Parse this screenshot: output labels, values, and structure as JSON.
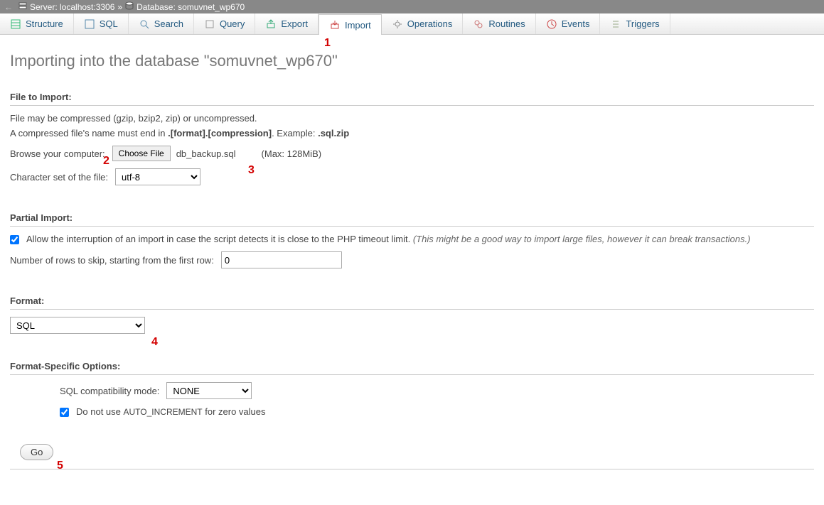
{
  "breadcrumb": {
    "back_arrow": "←",
    "server_label": "Server: localhost:3306",
    "sep": "»",
    "db_label": "Database: somuvnet_wp670"
  },
  "tabs": [
    {
      "label": "Structure",
      "icon": "structure"
    },
    {
      "label": "SQL",
      "icon": "sql"
    },
    {
      "label": "Search",
      "icon": "search"
    },
    {
      "label": "Query",
      "icon": "query"
    },
    {
      "label": "Export",
      "icon": "export"
    },
    {
      "label": "Import",
      "icon": "import",
      "active": true
    },
    {
      "label": "Operations",
      "icon": "operations"
    },
    {
      "label": "Routines",
      "icon": "routines"
    },
    {
      "label": "Events",
      "icon": "events"
    },
    {
      "label": "Triggers",
      "icon": "triggers"
    }
  ],
  "page": {
    "title": "Importing into the database \"somuvnet_wp670\""
  },
  "file_section": {
    "title": "File to Import:",
    "help1": "File may be compressed (gzip, bzip2, zip) or uncompressed.",
    "help2_a": "A compressed file's name must end in ",
    "help2_b": ".[format].[compression]",
    "help2_c": ". Example: ",
    "help2_d": ".sql.zip",
    "browse_label": "Browse your computer:",
    "choose_button": "Choose File",
    "file_name": "db_backup.sql",
    "max_size": "(Max: 128MiB)",
    "charset_label": "Character set of the file:",
    "charset_value": "utf-8"
  },
  "partial_section": {
    "title": "Partial Import:",
    "allow_checked": true,
    "allow_label": "Allow the interruption of an import in case the script detects it is close to the PHP timeout limit. ",
    "allow_hint": "(This might be a good way to import large files, however it can break transactions.)",
    "skip_label": "Number of rows to skip, starting from the first row:",
    "skip_value": "0"
  },
  "format_section": {
    "title": "Format:",
    "value": "SQL"
  },
  "options_section": {
    "title": "Format-Specific Options:",
    "compat_label": "SQL compatibility mode:",
    "compat_value": "NONE",
    "autoinc_checked": true,
    "autoinc_label_a": "Do not use ",
    "autoinc_label_b": "AUTO_INCREMENT",
    "autoinc_label_c": " for zero values"
  },
  "go_button": "Go",
  "annotations": {
    "a1": "1",
    "a2": "2",
    "a3": "3",
    "a4": "4",
    "a5": "5"
  }
}
